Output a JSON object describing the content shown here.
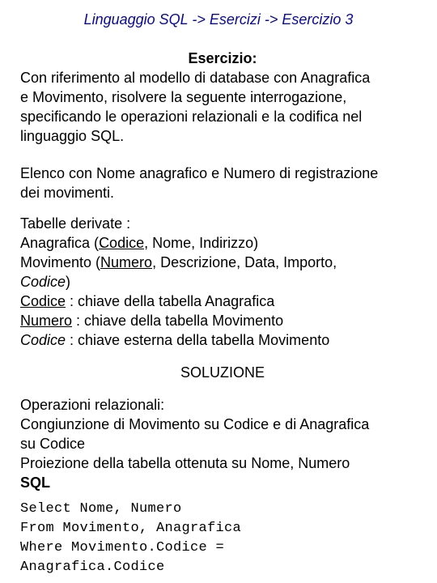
{
  "title": "Linguaggio SQL -> Esercizi -> Esercizio 3",
  "exercise": {
    "heading": "Esercizio:",
    "lines": [
      "Con riferimento al modello di database con Anagrafica",
      "e Movimento, risolvere la seguente interrogazione,",
      "specificando le operazioni relazionali e la codifica nel",
      "linguaggio SQL."
    ]
  },
  "request": {
    "lines": [
      "Elenco con Nome anagrafico e Numero di registrazione",
      "dei movimenti."
    ]
  },
  "tables": {
    "heading": "Tabelle derivate :",
    "anagrafica": {
      "name": "Anagrafica (",
      "key": "Codice",
      "rest": ", Nome, Indirizzo)"
    },
    "movimento": {
      "name": "Movimento (",
      "key": "Numero",
      "rest": ", Descrizione, Data, Importo,",
      "fk": "Codice",
      "close": ")"
    },
    "keys": [
      {
        "field": "Codice",
        "style": "underline",
        "text": " : chiave della tabella Anagrafica"
      },
      {
        "field": "Numero",
        "style": "underline",
        "text": " : chiave della tabella Movimento"
      },
      {
        "field": "Codice",
        "style": "italic",
        "text": " : chiave esterna della tabella Movimento"
      }
    ]
  },
  "solution": {
    "heading": "SOLUZIONE",
    "ops_heading": "Operazioni relazionali:",
    "ops_lines": [
      "Congiunzione di Movimento su Codice e di Anagrafica",
      "su Codice",
      "Proiezione della tabella ottenuta su Nome, Numero"
    ],
    "sql_heading": "SQL",
    "sql_lines": [
      "Select Nome, Numero",
      "From Movimento, Anagrafica",
      "Where Movimento.Codice =",
      "Anagrafica.Codice"
    ]
  }
}
